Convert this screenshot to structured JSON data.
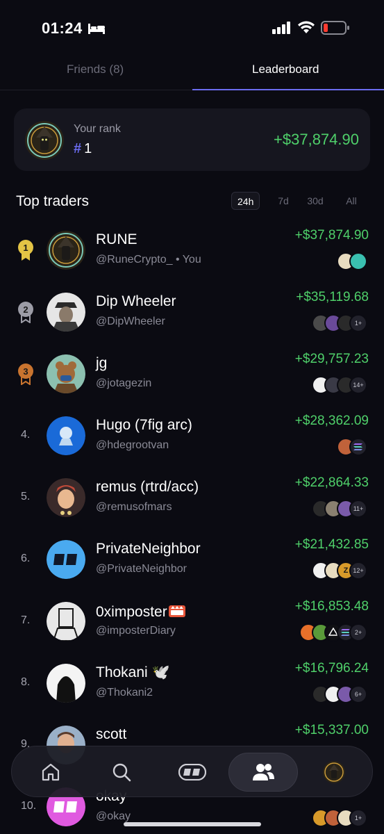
{
  "status_bar": {
    "time": "01:24"
  },
  "tabs": {
    "friends": "Friends (8)",
    "leaderboard": "Leaderboard"
  },
  "your_rank": {
    "label": "Your rank",
    "hash": "#",
    "rank": "1",
    "pnl": "+$37,874.90"
  },
  "top_traders": {
    "title": "Top traders",
    "filters": [
      "24h",
      "7d",
      "30d",
      "All"
    ],
    "active_filter": "24h"
  },
  "colors": {
    "accent": "#6b6cf0",
    "positive": "#4fd06a",
    "gold": "#e3c445",
    "silver": "#9c9ca6",
    "bronze": "#c9742f"
  },
  "traders": [
    {
      "rank": "1",
      "name": "RUNE",
      "handle": "@RuneCrypto_ • You",
      "pnl": "+$37,874.90",
      "more": ""
    },
    {
      "rank": "2",
      "name": "Dip Wheeler",
      "handle": "@DipWheeler",
      "pnl": "+$35,119.68",
      "more": "1+"
    },
    {
      "rank": "3",
      "name": "jg",
      "handle": "@jotagezin",
      "pnl": "+$29,757.23",
      "more": "14+"
    },
    {
      "rank": "4.",
      "name": "Hugo (7fig arc)",
      "handle": "@hdegrootvan",
      "pnl": "+$28,362.09",
      "more": ""
    },
    {
      "rank": "5.",
      "name": "remus (rtrd/acc)",
      "handle": "@remusofmars",
      "pnl": "+$22,864.33",
      "more": "11+"
    },
    {
      "rank": "6.",
      "name": "PrivateNeighbor",
      "handle": "@PrivateNeighbor",
      "pnl": "+$21,432.85",
      "more": "12+"
    },
    {
      "rank": "7.",
      "name": "0ximposter",
      "handle": "@imposterDiary",
      "pnl": "+$16,853.48",
      "more": "2+"
    },
    {
      "rank": "8.",
      "name": "Thokani 🕊️",
      "handle": "@Thokani2",
      "pnl": "+$16,796.24",
      "more": "6+"
    },
    {
      "rank": "9.",
      "name": "scott",
      "handle": "",
      "pnl": "+$15,337.00",
      "more": ""
    },
    {
      "rank": "10.",
      "name": "okay",
      "handle": "@okay",
      "pnl": "",
      "more": "1+"
    }
  ],
  "nav": [
    "home-icon",
    "search-icon",
    "trade-icon",
    "friends-icon",
    "profile-avatar"
  ]
}
